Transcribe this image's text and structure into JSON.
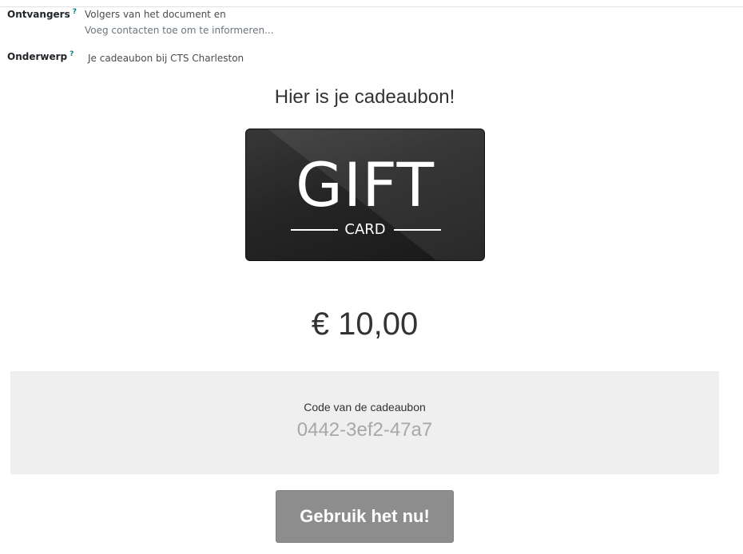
{
  "composer": {
    "recipients_label": "Ontvangers",
    "recipients_value": "Volgers van het document en",
    "recipients_placeholder": "Voeg contacten toe om te informeren...",
    "subject_label": "Onderwerp",
    "subject_value": "Je cadeaubon bij CTS Charleston",
    "help_mark": "?"
  },
  "email": {
    "heading": "Hier is je cadeaubon!",
    "card_image": {
      "word": "GIFT",
      "subword": "CARD"
    },
    "amount": "€ 10,00",
    "code_label": "Code van de cadeaubon",
    "code_value": "0442-3ef2-47a7",
    "button_label": "Gebruik het nu!"
  },
  "colors": {
    "help_mark": "#017e84",
    "code_box_bg": "#efefef",
    "button_bg": "#8d8d8d",
    "card_bg": "#2b2b2b"
  }
}
